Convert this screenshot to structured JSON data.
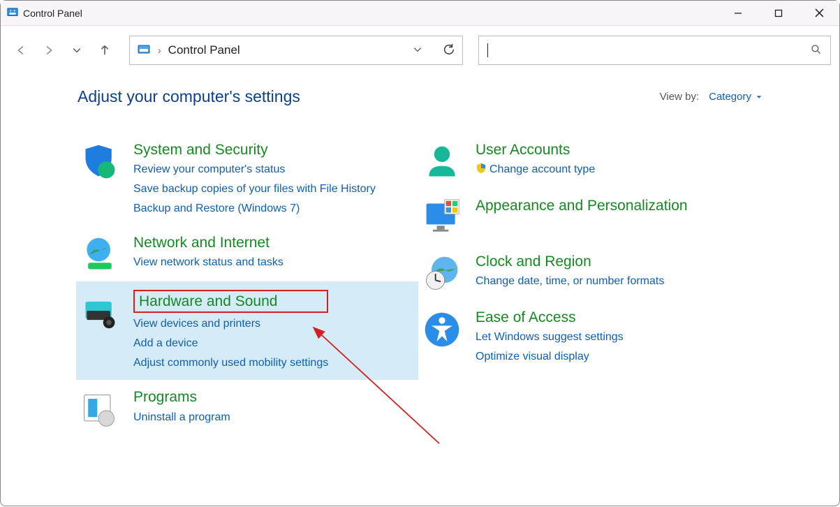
{
  "window": {
    "title": "Control Panel"
  },
  "breadcrumb": {
    "location": "Control Panel"
  },
  "subheader": {
    "heading": "Adjust your computer's settings",
    "viewby_label": "View by:",
    "viewby_value": "Category"
  },
  "categories": {
    "left": [
      {
        "title": "System and Security",
        "links": [
          "Review your computer's status",
          "Save backup copies of your files with File History",
          "Backup and Restore (Windows 7)"
        ]
      },
      {
        "title": "Network and Internet",
        "links": [
          "View network status and tasks"
        ]
      },
      {
        "title": "Hardware and Sound",
        "highlighted": true,
        "boxed": true,
        "links": [
          "View devices and printers",
          "Add a device",
          "Adjust commonly used mobility settings"
        ]
      },
      {
        "title": "Programs",
        "links": [
          "Uninstall a program"
        ]
      }
    ],
    "right": [
      {
        "title": "User Accounts",
        "links": [
          "Change account type"
        ],
        "shield_on_first": true
      },
      {
        "title": "Appearance and Personalization",
        "links": []
      },
      {
        "title": "Clock and Region",
        "links": [
          "Change date, time, or number formats"
        ]
      },
      {
        "title": "Ease of Access",
        "links": [
          "Let Windows suggest settings",
          "Optimize visual display"
        ]
      }
    ]
  }
}
